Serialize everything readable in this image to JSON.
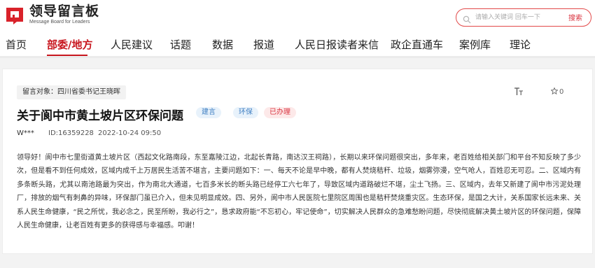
{
  "brand": {
    "title": "领导留言板",
    "subtitle": "Message Board for Leaders",
    "accent": "#c8161e"
  },
  "search": {
    "placeholder": "请输入关键词 回车一下",
    "button_label": "搜索",
    "icon": "search-icon"
  },
  "nav": {
    "items": [
      {
        "label": "首页"
      },
      {
        "label": "部委/地方",
        "active": true
      },
      {
        "label": "人民建议"
      },
      {
        "label": "话题"
      },
      {
        "label": "数据"
      },
      {
        "label": "报道"
      },
      {
        "label": "人民日报读者来信"
      },
      {
        "label": "政企直通车"
      },
      {
        "label": "案例库"
      },
      {
        "label": "理论"
      }
    ]
  },
  "message": {
    "target": "留言对象：四川省委书记王晓晖",
    "font_toggle": "T T",
    "like_count": "0",
    "title": "关于阆中市黄土坡片区环保问题",
    "tags": [
      "建言",
      "环保",
      "已办理"
    ],
    "user": "W***",
    "id": "ID:16359228",
    "time": "2022-10-24 09:50",
    "body": "领导好！阆中市七里街道黄土坡片区（西起文化路南段，东至嘉陵江边，北起长青路，南达汉王祠路），长期以来环保问题很突出，多年来，老百姓给相关部门和平台不知反映了多少次，但是看不到任何成效，区域内成千上万居民生活苦不堪言，主要问题如下：一、每天不论是早中晚，都有人焚烧秸秆、垃圾，烟雾弥漫，空气呛人，百姓忍无可忍。二、区域内有多条断头路，尤其以南池路最为突出，作为南北大通道，七百多米长的断头路已经停工六七年了，导致区域内道路破烂不堪，尘土飞扬。三、区域内，去年又新建了阆中市污泥处理厂，排放的烟气有刺鼻的异味，环保部门虽已介入，但未见明显成效。四、另外，阆中市人民医院七里院区周围也是秸秆焚烧重灾区。生态环保，是国之大计，关系国家长远未来、关系人民生命健康，“民之所忧，我必念之，民至所盼，我必行之”，恳求政府能“不忘初心，牢记使命”，切实解决人民群众的急难愁盼问题，尽快彻底解决黄土坡片区的环保问题，保障人民生命健康，让老百姓有更多的获得感与幸福感。叩谢！"
  }
}
